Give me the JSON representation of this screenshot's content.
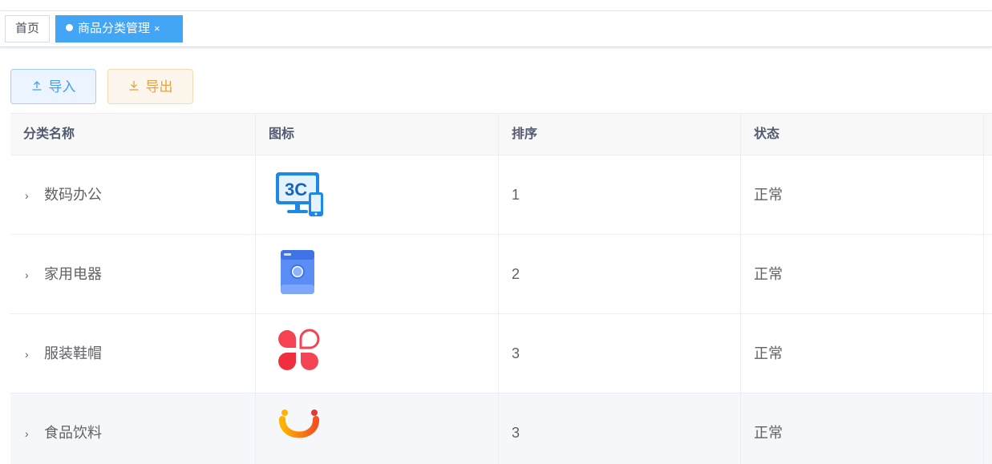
{
  "tags": {
    "home": "首页",
    "active": "商品分类管理",
    "close": "×"
  },
  "toolbar": {
    "import_label": "导入",
    "export_label": "导出"
  },
  "table": {
    "columns": [
      "分类名称",
      "图标",
      "排序",
      "状态"
    ],
    "rows": [
      {
        "name": "数码办公",
        "icon": "3c-devices-icon",
        "sort": "1",
        "status": "正常"
      },
      {
        "name": "家用电器",
        "icon": "washing-machine-icon",
        "sort": "2",
        "status": "正常"
      },
      {
        "name": "服装鞋帽",
        "icon": "clover-icon",
        "sort": "3",
        "status": "正常"
      },
      {
        "name": "食品饮料",
        "icon": "smile-icon",
        "sort": "3",
        "status": "正常"
      }
    ]
  },
  "colors": {
    "primary": "#42a5f5",
    "import": "#409eff",
    "export": "#e6a23c"
  }
}
